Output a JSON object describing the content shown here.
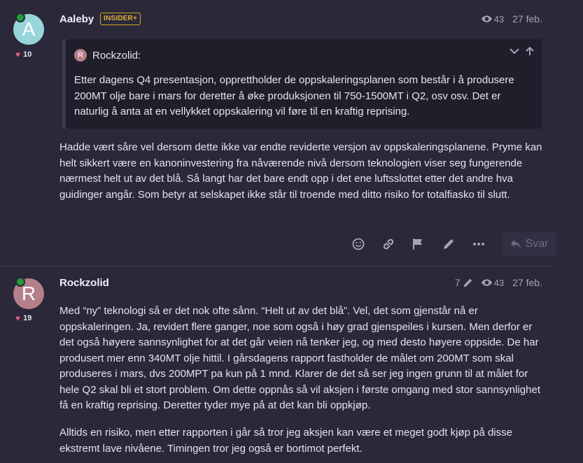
{
  "posts": [
    {
      "avatar_letter": "A",
      "avatar_color": "#98d5db",
      "username": "Aaleby",
      "badge": "INSIDER+",
      "likes": "10",
      "views": "43",
      "date": "27 feb.",
      "quote": {
        "author_initial": "R",
        "author": "Rockzolid:",
        "text": "Etter dagens Q4 presentasjon, opprettholder de oppskaleringsplanen som består i å produsere 200MT olje bare i mars for deretter å øke produksjonen til 750-1500MT i Q2, osv osv. Det er naturlig å anta at en vellykket oppskalering vil føre til en kraftig reprising."
      },
      "body": "Hadde vært såre vel dersom dette ikke var endte reviderte versjon av oppskaleringsplanene. Pryme kan helt sikkert være en kanoninvestering fra nåværende nivå dersom teknologien viser seg fungerende nærmest helt ut av det blå. Så langt har det bare endt opp i det ene luftsslottet etter det andre hva guidinger angår. Som betyr at selskapet ikke står til troende med ditto risiko for totalfiasko til slutt.",
      "reply_label": "Svar"
    },
    {
      "avatar_letter": "R",
      "avatar_color": "#b58089",
      "username": "Rockzolid",
      "likes": "19",
      "edits": "7",
      "views": "43",
      "date": "27 feb.",
      "body": [
        "Med “ny” teknologi så er det nok ofte sånn. “Helt ut av det blå”. Vel, det som gjenstår nå er oppskaleringen. Ja, revidert flere ganger, noe som også i høy grad gjenspeiles i kursen. Men derfor er det også høyere sannsynlighet for at det går veien nå tenker jeg, og med desto høyere oppside. De har produsert mer enn 340MT olje hittil. I gårsdagens rapport fastholder de målet om 200MT som skal produseres i mars, dvs 200MPT pa kun på 1 mnd. Klarer de det så ser jeg ingen grunn til at målet for hele Q2 skal bli et stort problem. Om dette oppnås så vil aksjen i første omgang med stor sannsynlighet få en kraftig reprising. Deretter tyder mye på at det kan bli oppkjøp.",
        "Alltids en risiko, men etter rapporten i går så tror jeg aksjen kan være et meget godt kjøp på disse ekstremt lave nivåene. Timingen tror jeg også er bortimot perfekt."
      ]
    }
  ],
  "icons": [
    "heart-icon",
    "eye-icon",
    "chevron-down-icon",
    "arrow-up-icon",
    "smile-icon",
    "link-icon",
    "flag-icon",
    "pencil-icon",
    "more-icon",
    "reply-icon"
  ]
}
